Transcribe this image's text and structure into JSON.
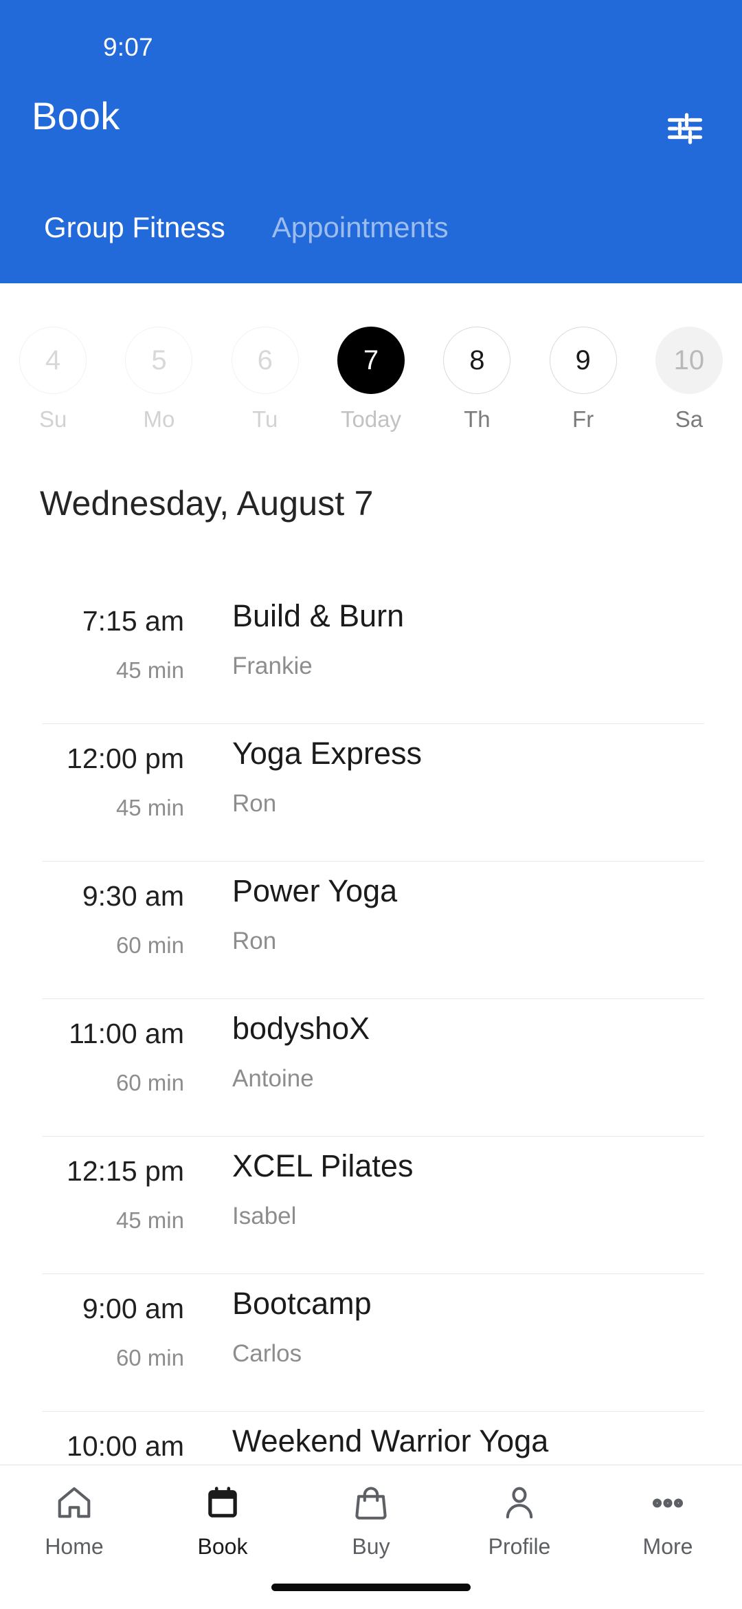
{
  "theme": {
    "header_blue": "#2269d9",
    "tab_inactive": "#9cbdee",
    "today_fill": "#000000",
    "muted_text": "#8d8d8d"
  },
  "status_bar": {
    "time": "9:07"
  },
  "header": {
    "title": "Book",
    "filter_icon": "tune-icon",
    "tabs": [
      {
        "label": "Group Fitness",
        "active": true
      },
      {
        "label": "Appointments",
        "active": false
      }
    ]
  },
  "date_strip": {
    "days": [
      {
        "num": "4",
        "label": "Su",
        "state": "disabled"
      },
      {
        "num": "5",
        "label": "Mo",
        "state": "disabled"
      },
      {
        "num": "6",
        "label": "Tu",
        "state": "disabled"
      },
      {
        "num": "7",
        "label": "Today",
        "state": "today"
      },
      {
        "num": "8",
        "label": "Th",
        "state": "normal"
      },
      {
        "num": "9",
        "label": "Fr",
        "state": "normal"
      },
      {
        "num": "10",
        "label": "Sa",
        "state": "filled"
      }
    ]
  },
  "day_heading": "Wednesday, August 7",
  "classes": [
    {
      "time": "7:15 am",
      "duration": "45 min",
      "name": "Build & Burn",
      "instructor": "Frankie"
    },
    {
      "time": "12:00 pm",
      "duration": "45 min",
      "name": "Yoga Express",
      "instructor": "Ron"
    },
    {
      "time": "9:30 am",
      "duration": "60 min",
      "name": "Power Yoga",
      "instructor": "Ron"
    },
    {
      "time": "11:00 am",
      "duration": "60 min",
      "name": "bodyshoX",
      "instructor": "Antoine"
    },
    {
      "time": "12:15 pm",
      "duration": "45 min",
      "name": "XCEL Pilates",
      "instructor": "Isabel"
    },
    {
      "time": "9:00 am",
      "duration": "60 min",
      "name": "Bootcamp",
      "instructor": "Carlos"
    },
    {
      "time": "10:00 am",
      "duration": "",
      "name": "Weekend Warrior Yoga",
      "instructor": ""
    }
  ],
  "bottom_nav": {
    "items": [
      {
        "label": "Home",
        "icon": "home-icon",
        "active": false
      },
      {
        "label": "Book",
        "icon": "calendar-icon",
        "active": true
      },
      {
        "label": "Buy",
        "icon": "bag-icon",
        "active": false
      },
      {
        "label": "Profile",
        "icon": "person-icon",
        "active": false
      },
      {
        "label": "More",
        "icon": "ellipsis-icon",
        "active": false
      }
    ]
  }
}
